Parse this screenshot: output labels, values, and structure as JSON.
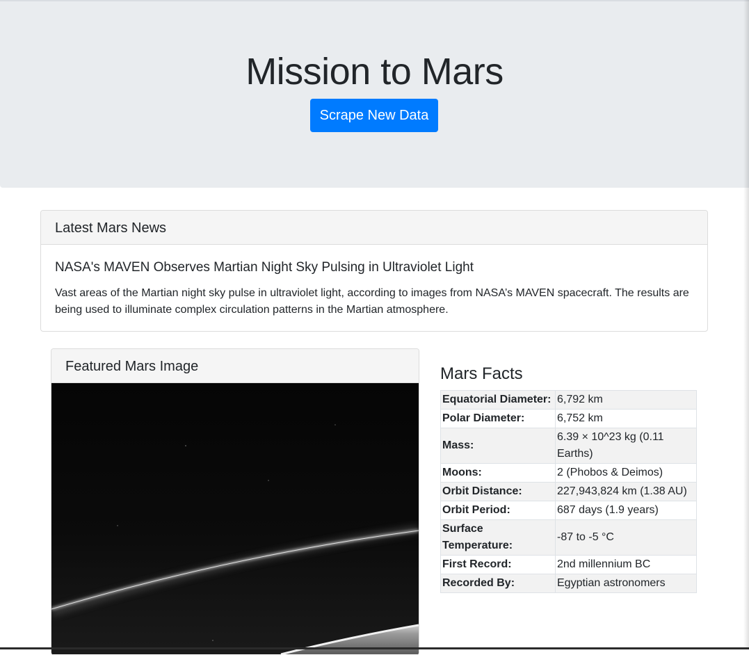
{
  "jumbotron": {
    "title": "Mission to Mars",
    "button_label": "Scrape New Data"
  },
  "news": {
    "header": "Latest Mars News",
    "title": "NASA's MAVEN Observes Martian Night Sky Pulsing in Ultraviolet Light",
    "paragraph": "Vast areas of the Martian night sky pulse in ultraviolet light, according to images from NASA’s MAVEN spacecraft. The results are being used to illuminate complex circulation patterns in the Martian atmosphere."
  },
  "featured": {
    "header": "Featured Mars Image"
  },
  "facts": {
    "title": "Mars Facts",
    "rows": [
      {
        "label": "Equatorial Diameter:",
        "value": "6,792 km"
      },
      {
        "label": "Polar Diameter:",
        "value": "6,752 km"
      },
      {
        "label": "Mass:",
        "value": "6.39 × 10^23 kg (0.11 Earths)"
      },
      {
        "label": "Moons:",
        "value": "2 (Phobos & Deimos)"
      },
      {
        "label": "Orbit Distance:",
        "value": "227,943,824 km (1.38 AU)"
      },
      {
        "label": "Orbit Period:",
        "value": "687 days (1.9 years)"
      },
      {
        "label": "Surface Temperature:",
        "value": "-87 to -5 °C"
      },
      {
        "label": "First Record:",
        "value": "2nd millennium BC"
      },
      {
        "label": "Recorded By:",
        "value": "Egyptian astronomers"
      }
    ]
  },
  "colors": {
    "primary": "#007bff",
    "jumbotron_bg": "#e9ecef"
  }
}
